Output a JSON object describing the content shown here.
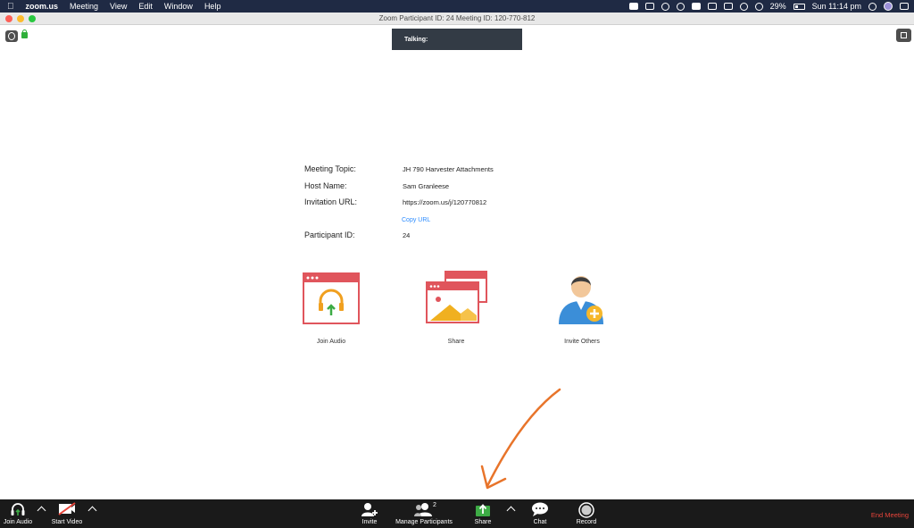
{
  "menubar": {
    "app_name": "zoom.us",
    "menus": [
      "Meeting",
      "View",
      "Edit",
      "Window",
      "Help"
    ],
    "battery": "29%",
    "clock": "Sun 11:14 pm"
  },
  "window": {
    "title": "Zoom Participant ID: 24   Meeting ID: 120-770-812"
  },
  "talking_indicator": "Talking:",
  "meeting_info": {
    "topic_label": "Meeting Topic:",
    "topic_value": "JH 790 Harvester Attachments",
    "host_label": "Host Name:",
    "host_value": "Sam Granleese",
    "url_label": "Invitation URL:",
    "url_value": "https://zoom.us/j/120770812",
    "copy_url": "Copy URL",
    "participant_label": "Participant ID:",
    "participant_value": "24"
  },
  "actions": {
    "join_audio": "Join Audio",
    "share": "Share",
    "invite_others": "Invite Others"
  },
  "toolbar": {
    "join_audio": "Join Audio",
    "start_video": "Start Video",
    "invite": "Invite",
    "manage_participants": "Manage Participants",
    "participant_count": "2",
    "share": "Share",
    "chat": "Chat",
    "record": "Record",
    "end_meeting": "End Meeting"
  },
  "colors": {
    "menubar_bg": "#1f2a44",
    "toolbar_bg": "#1a1a1a",
    "accent_link": "#2d8cff",
    "end_meeting": "#e8443a",
    "share_green": "#3dab45",
    "tile_red": "#e0555c",
    "annotation_orange": "#e8742a"
  }
}
